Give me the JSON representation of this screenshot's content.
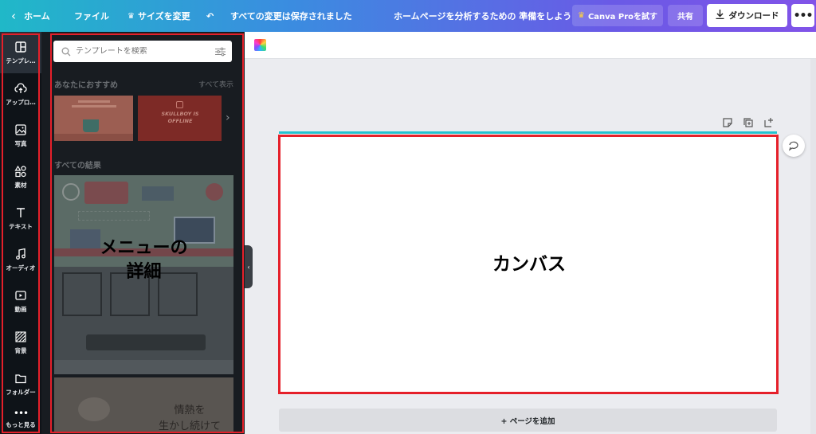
{
  "topbar": {
    "home_label": "ホーム",
    "file_label": "ファイル",
    "resize_label": "サイズを変更",
    "saved_status": "すべての変更は保存されました",
    "doc_title": "ホームページを分析するための 準備をしよう",
    "pro_label": "Canva Proを試す",
    "share_label": "共有",
    "download_label": "ダウンロード",
    "more_label": "•••"
  },
  "rail": {
    "items": [
      {
        "label": "テンプレ…",
        "icon": "template-icon"
      },
      {
        "label": "アップロ…",
        "icon": "upload-icon"
      },
      {
        "label": "写真",
        "icon": "photo-icon"
      },
      {
        "label": "素材",
        "icon": "elements-icon"
      },
      {
        "label": "テキスト",
        "icon": "text-icon"
      },
      {
        "label": "オーディオ",
        "icon": "audio-icon"
      },
      {
        "label": "動画",
        "icon": "video-icon"
      },
      {
        "label": "背景",
        "icon": "background-icon"
      },
      {
        "label": "フォルダー",
        "icon": "folder-icon"
      },
      {
        "label": "もっと見る",
        "icon": "more-icon"
      }
    ]
  },
  "panel": {
    "search_placeholder": "テンプレートを検索",
    "recommended_title": "あなたにおすすめ",
    "show_all_label": "すべて表示",
    "all_results_title": "すべての結果",
    "thumb2_text": "SKULLBOY IS OFFLINE",
    "thumb3_text_line1": "情熱を",
    "thumb3_text_line2": "生かし続けて",
    "overlay_line1": "メニューの",
    "overlay_line2": "詳細"
  },
  "canvas": {
    "label": "カンバス",
    "add_page_label": "+ ページを追加"
  },
  "colors": {
    "highlight_frame": "#e5202a",
    "canvas_accent": "#24c2cf",
    "rail_bg": "#0e1318"
  }
}
